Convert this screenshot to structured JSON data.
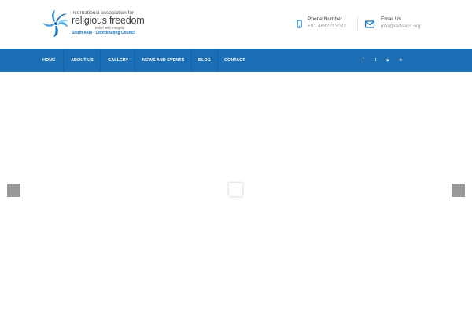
{
  "logo": {
    "line1": "international association for",
    "line2": "religious freedom",
    "line3": "belief with integrity",
    "line4": "South Asia - Coordinating Council"
  },
  "contacts": {
    "phone": {
      "label": "Phone Number",
      "value": "+91 4682213082",
      "icon": "mobile-phone-icon"
    },
    "email": {
      "label": "Email Us",
      "value": "info@iarfsacc.org",
      "icon": "envelope-icon"
    }
  },
  "nav": {
    "items": [
      "HOME",
      "ABOUT US",
      "GALLERY",
      "NEWS AND EVENTS",
      "BLOG",
      "CONTACT"
    ]
  },
  "social": {
    "facebook": "f",
    "twitter": "t",
    "youtube": "▶",
    "linkedin": "in"
  },
  "colors": {
    "nav_bg": "#1c6fb5",
    "accent": "#1a74bb",
    "slider_arrow": "#999999"
  }
}
